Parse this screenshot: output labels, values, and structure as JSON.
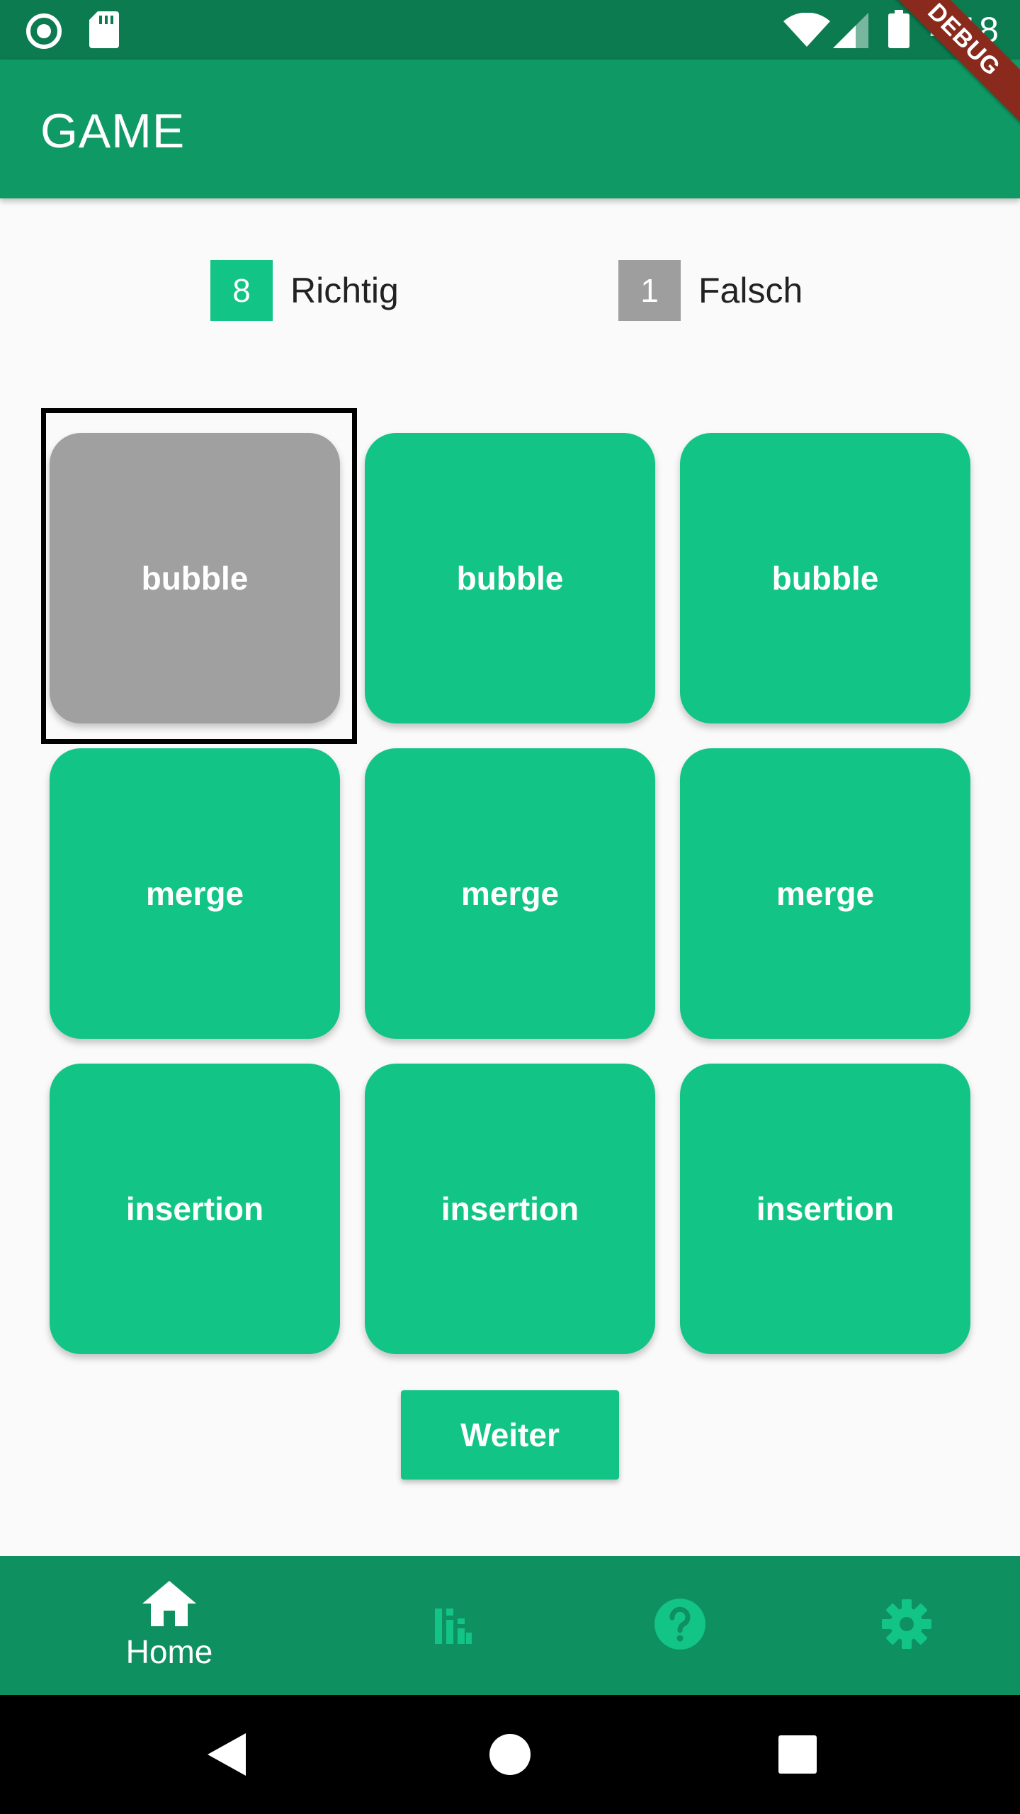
{
  "status_bar": {
    "time": "4:18",
    "icons": [
      "record-icon",
      "sd-card-icon",
      "wifi-icon",
      "signal-icon",
      "battery-icon"
    ]
  },
  "debug_banner": "DEBUG",
  "app_bar": {
    "title": "GAME"
  },
  "score": {
    "correct": {
      "count": "8",
      "label": "Richtig"
    },
    "wrong": {
      "count": "1",
      "label": "Falsch"
    }
  },
  "grid": {
    "rows": [
      [
        "bubble",
        "bubble",
        "bubble"
      ],
      [
        "merge",
        "merge",
        "merge"
      ],
      [
        "insertion",
        "insertion",
        "insertion"
      ]
    ],
    "selected": "row 1, column 1"
  },
  "next_button": {
    "label": "Weiter"
  },
  "bottom_nav": {
    "items": [
      {
        "icon": "home-icon",
        "label": "Home",
        "active": true
      },
      {
        "icon": "bar-chart-icon",
        "label": "",
        "active": false
      },
      {
        "icon": "help-icon",
        "label": "",
        "active": false
      },
      {
        "icon": "settings-icon",
        "label": "",
        "active": false
      }
    ]
  },
  "colors": {
    "primary": "#13c487",
    "app_bar": "#0f9a65",
    "status_bar": "#0c7b50",
    "bottom_nav": "#0f9060",
    "inactive_icon": "#13c487",
    "neutral": "#9e9e9e"
  }
}
